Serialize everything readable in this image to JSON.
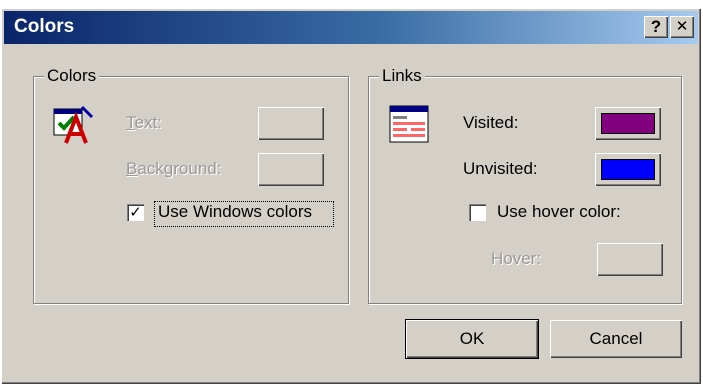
{
  "window": {
    "title": "Colors",
    "help_label": "?",
    "close_label": "✕"
  },
  "colors_group": {
    "legend": "Colors",
    "icon": "text-color-icon",
    "text_label": "Text:",
    "background_label": "Background:",
    "use_windows_colors_label": "Use Windows colors",
    "use_windows_colors_checked": true
  },
  "links_group": {
    "legend": "Links",
    "icon": "web-page-icon",
    "visited_label": "Visited:",
    "visited_color": "#800080",
    "unvisited_label": "Unvisited:",
    "unvisited_color": "#0000ff",
    "use_hover_label": "Use hover color:",
    "use_hover_checked": false,
    "hover_label": "Hover:"
  },
  "buttons": {
    "ok": "OK",
    "cancel": "Cancel"
  }
}
